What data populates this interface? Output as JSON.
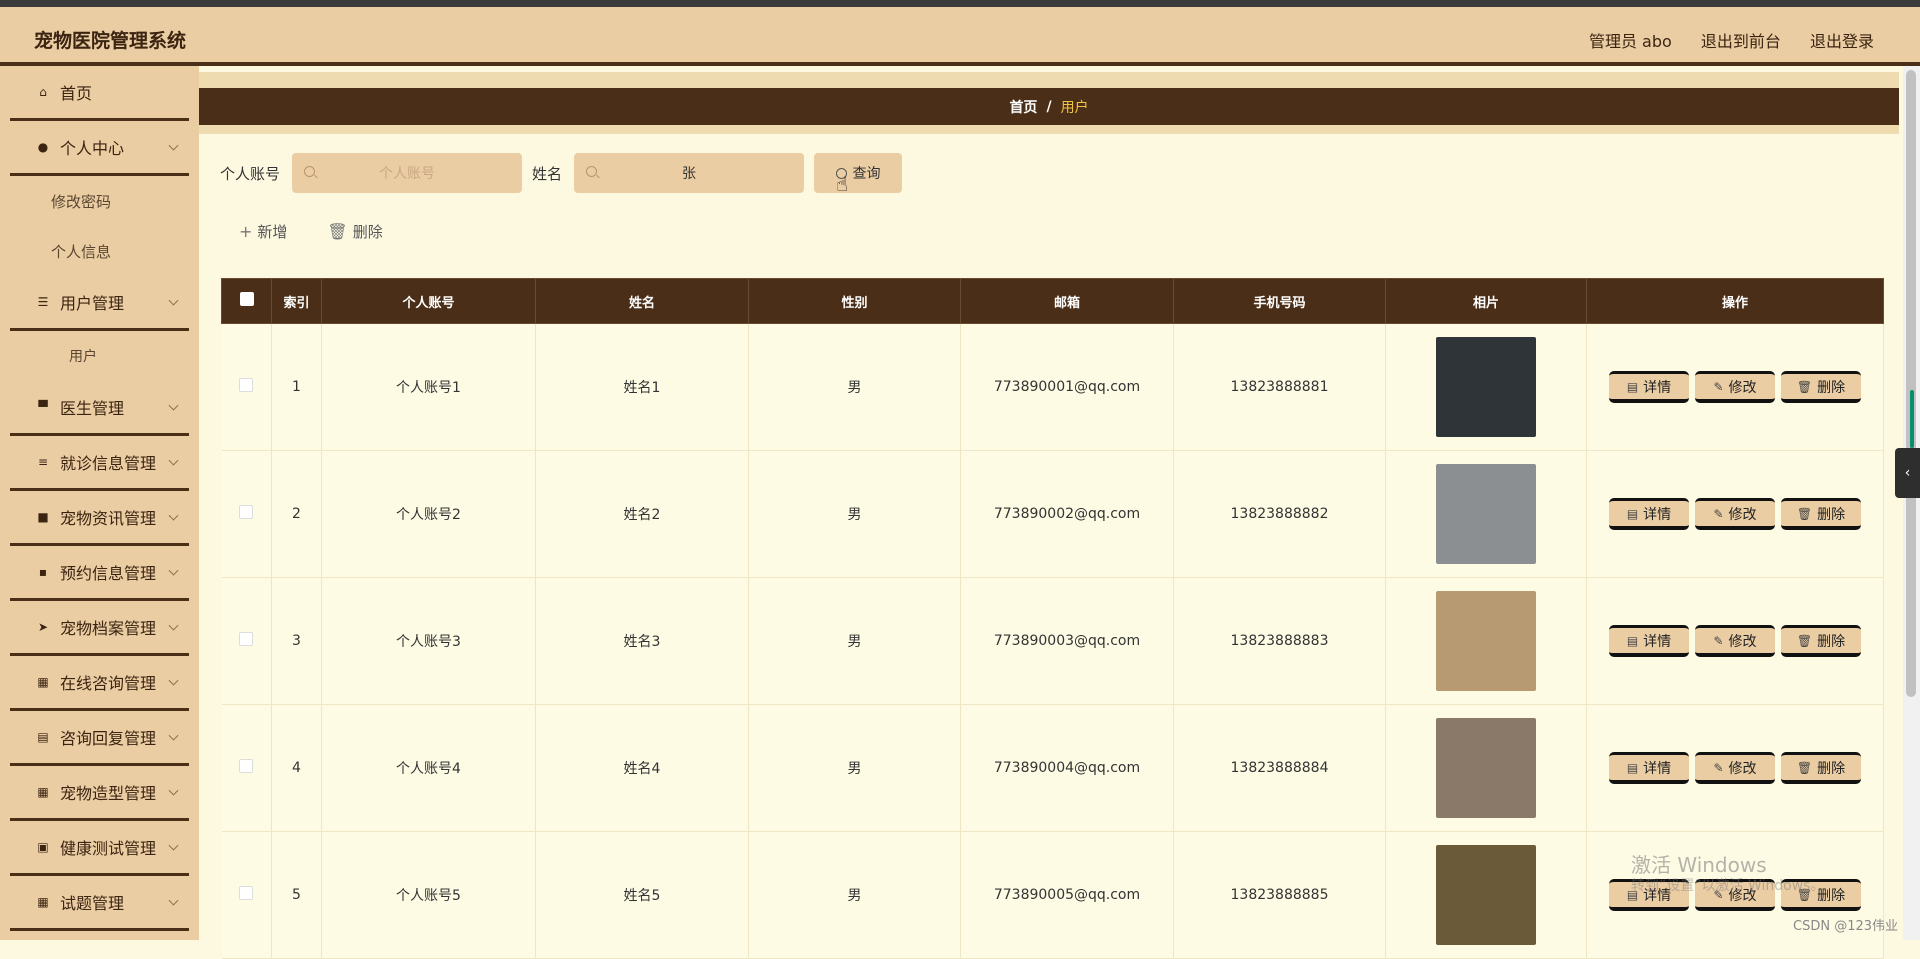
{
  "header": {
    "brand": "宠物医院管理系统",
    "admin": "管理员 abo",
    "to_front": "退出到前台",
    "logout": "退出登录"
  },
  "sidebar": {
    "items": [
      {
        "label": "首页",
        "icon": "home-icon",
        "glyph": "⌂",
        "chevron": false
      },
      {
        "label": "个人中心",
        "icon": "user-icon",
        "glyph": "●",
        "chevron": true
      },
      {
        "sub": "修改密码"
      },
      {
        "sub": "个人信息"
      },
      {
        "label": "用户管理",
        "icon": "list-icon",
        "glyph": "☰",
        "chevron": true
      },
      {
        "sub_deep": "用户"
      },
      {
        "label": "医生管理",
        "icon": "monitor-icon",
        "glyph": "▀",
        "chevron": true
      },
      {
        "label": "就诊信息管理",
        "icon": "sliders-icon",
        "glyph": "≡",
        "chevron": true
      },
      {
        "label": "宠物资讯管理",
        "icon": "briefcase-icon",
        "glyph": "■",
        "chevron": true
      },
      {
        "label": "预约信息管理",
        "icon": "message-icon",
        "glyph": "▪",
        "chevron": true
      },
      {
        "label": "宠物档案管理",
        "icon": "paper-plane-icon",
        "glyph": "➤",
        "chevron": true
      },
      {
        "label": "在线咨询管理",
        "icon": "grid-icon",
        "glyph": "▦",
        "chevron": true
      },
      {
        "label": "咨询回复管理",
        "icon": "clipboard-icon",
        "glyph": "▤",
        "chevron": true
      },
      {
        "label": "宠物造型管理",
        "icon": "grid-icon",
        "glyph": "▦",
        "chevron": true
      },
      {
        "label": "健康测试管理",
        "icon": "clipboard-x-icon",
        "glyph": "▣",
        "chevron": true
      },
      {
        "label": "试题管理",
        "icon": "grid-icon",
        "glyph": "▦",
        "chevron": true
      }
    ]
  },
  "breadcrumb": {
    "home": "首页",
    "sep": "/",
    "current": "用户"
  },
  "search": {
    "account_label": "个人账号",
    "account_placeholder": "个人账号",
    "name_label": "姓名",
    "name_value": "张",
    "query_button": "查询"
  },
  "actions": {
    "add": "新增",
    "delete": "删除"
  },
  "table": {
    "columns": [
      "索引",
      "个人账号",
      "姓名",
      "性别",
      "邮箱",
      "手机号码",
      "相片",
      "操作"
    ],
    "rows": [
      {
        "index": "1",
        "account": "个人账号1",
        "name": "姓名1",
        "gender": "男",
        "email": "773890001@qq.com",
        "phone": "13823888881",
        "photo_color": "#2f3438"
      },
      {
        "index": "2",
        "account": "个人账号2",
        "name": "姓名2",
        "gender": "男",
        "email": "773890002@qq.com",
        "phone": "13823888882",
        "photo_color": "#8c8f92"
      },
      {
        "index": "3",
        "account": "个人账号3",
        "name": "姓名3",
        "gender": "男",
        "email": "773890003@qq.com",
        "phone": "13823888883",
        "photo_color": "#b89a72"
      },
      {
        "index": "4",
        "account": "个人账号4",
        "name": "姓名4",
        "gender": "男",
        "email": "773890004@qq.com",
        "phone": "13823888884",
        "photo_color": "#8a7868"
      },
      {
        "index": "5",
        "account": "个人账号5",
        "name": "姓名5",
        "gender": "男",
        "email": "773890005@qq.com",
        "phone": "13823888885",
        "photo_color": "#6b5a3a"
      }
    ],
    "op_detail": "详情",
    "op_edit": "修改",
    "op_delete": "删除"
  },
  "overlay": {
    "watermark": "激活 Windows",
    "watermark_sub": "转到“设置”以激活 Windows。",
    "credit": "CSDN @123伟业"
  },
  "colors": {
    "accent_dark": "#4b2e17",
    "accent_light": "#ebcda4",
    "background": "#fdf9e1",
    "breadcrumb_current": "#f3c440"
  }
}
